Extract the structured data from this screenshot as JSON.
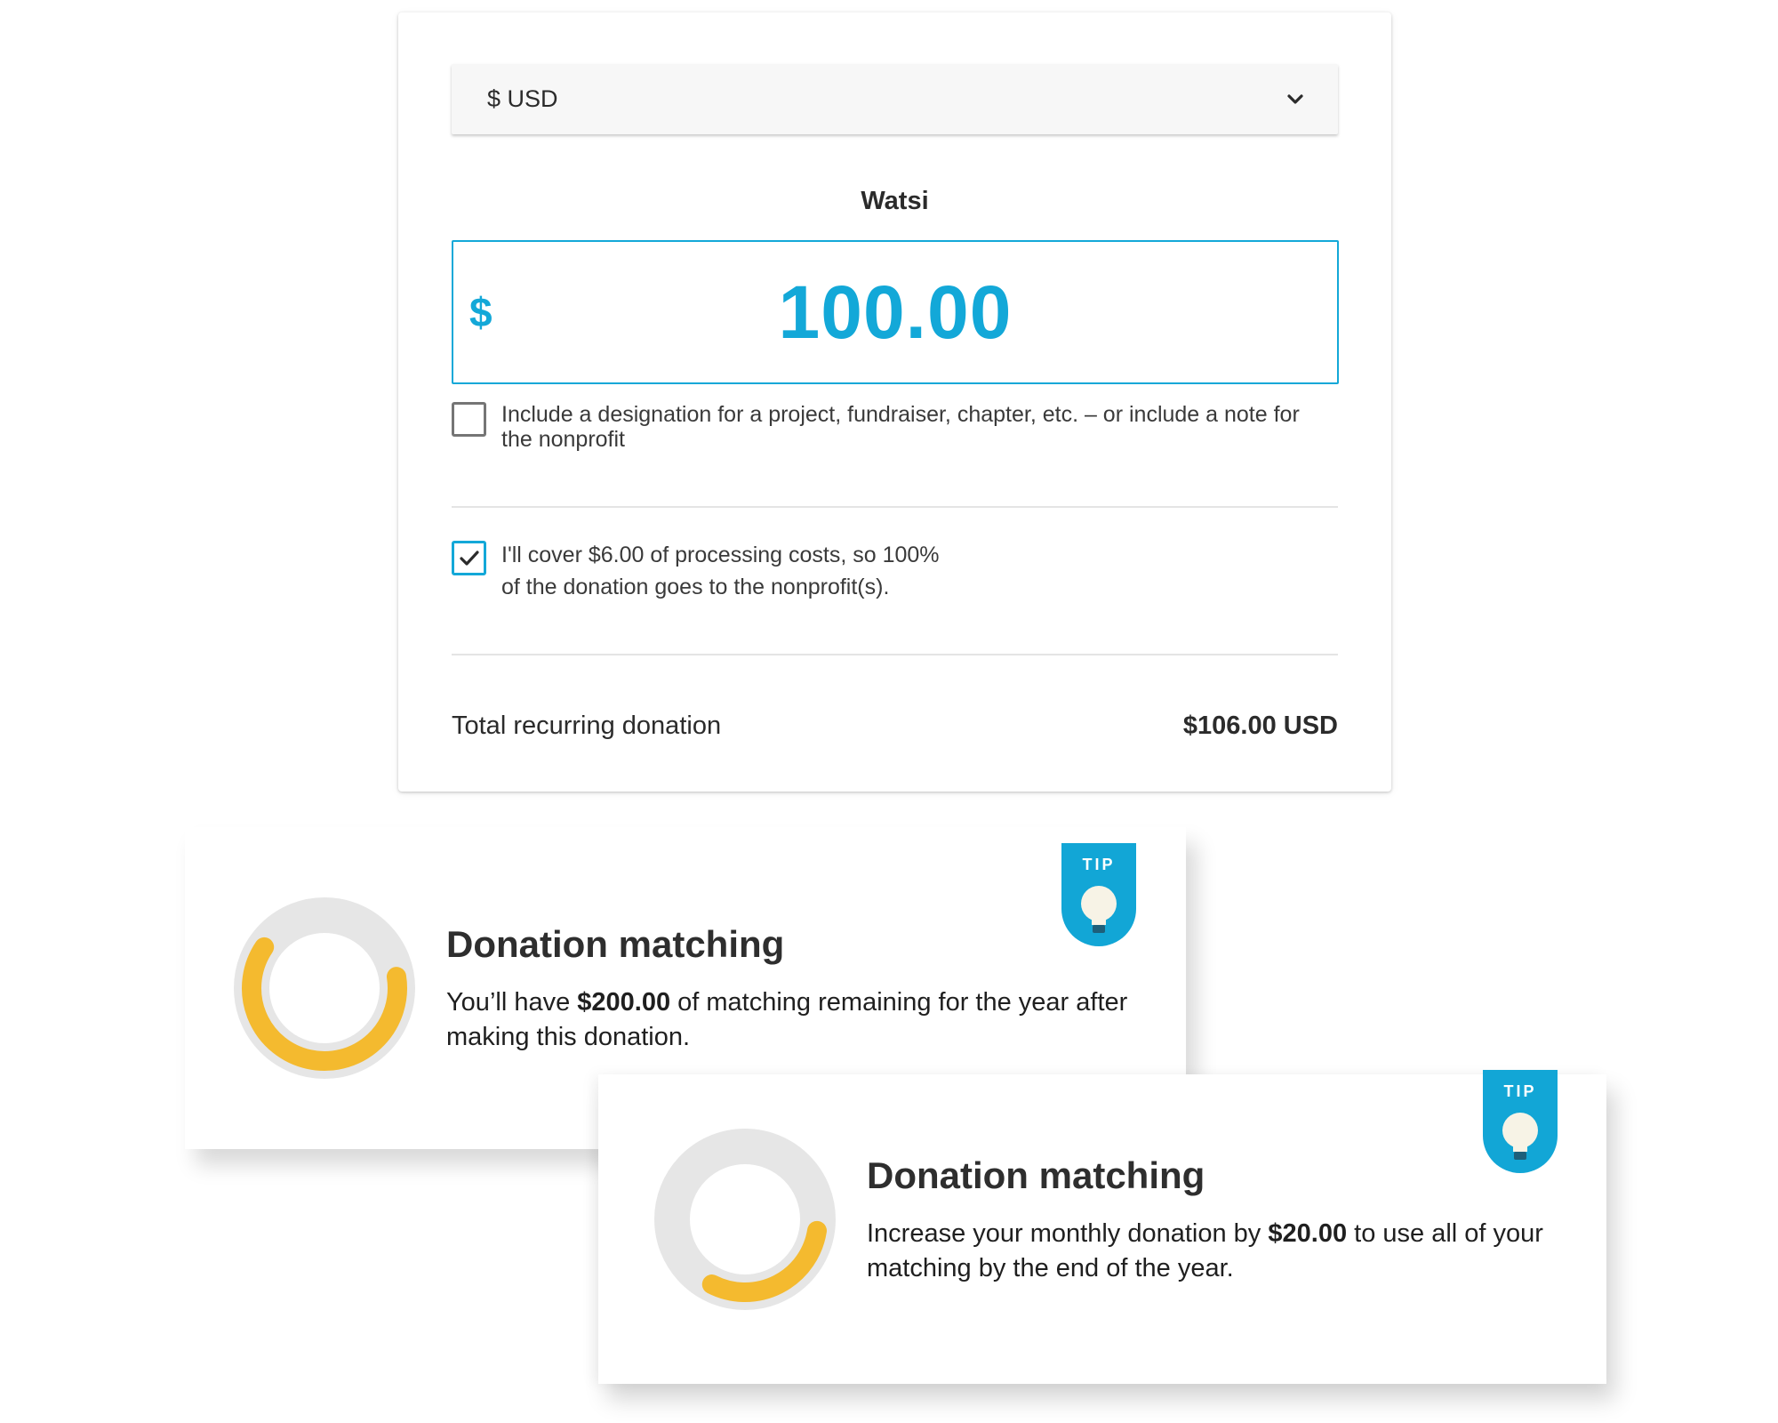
{
  "form": {
    "currency_select": {
      "value": "$ USD",
      "icon": "chevron-down-icon"
    },
    "nonprofit_name": "Watsi",
    "amount": {
      "currency_symbol": "$",
      "value": "100.00"
    },
    "designation": {
      "checked": false,
      "label": "Include a designation for a project, fundraiser, chapter, etc. – or include a note for the nonprofit"
    },
    "cover_costs": {
      "checked": true,
      "label_line1": "I'll cover $6.00 of processing costs, so 100%",
      "label_line2": "of the donation goes to the nonprofit(s)."
    },
    "total": {
      "label": "Total recurring donation",
      "value": "$106.00 USD"
    }
  },
  "tips": [
    {
      "badge": "TIP",
      "icon": "lightbulb-icon",
      "title": "Donation matching",
      "body_pre": "You’ll have ",
      "body_amount": "$200.00",
      "body_post": " of matching remaining for the year after making this donation.",
      "matching_used_fraction": 0.62
    },
    {
      "badge": "TIP",
      "icon": "lightbulb-icon",
      "title": "Donation matching",
      "body_pre": "Increase your monthly donation by ",
      "body_amount": "$20.00",
      "body_post": " to use all of your matching by the end of the year.",
      "matching_used_fraction": 0.3
    }
  ],
  "colors": {
    "accent": "#13a8d8",
    "ring_fill": "#f4ba2f",
    "ring_track": "#e6e6e6",
    "badge": "#12a6d6",
    "bulb": "#f7f3e6"
  }
}
